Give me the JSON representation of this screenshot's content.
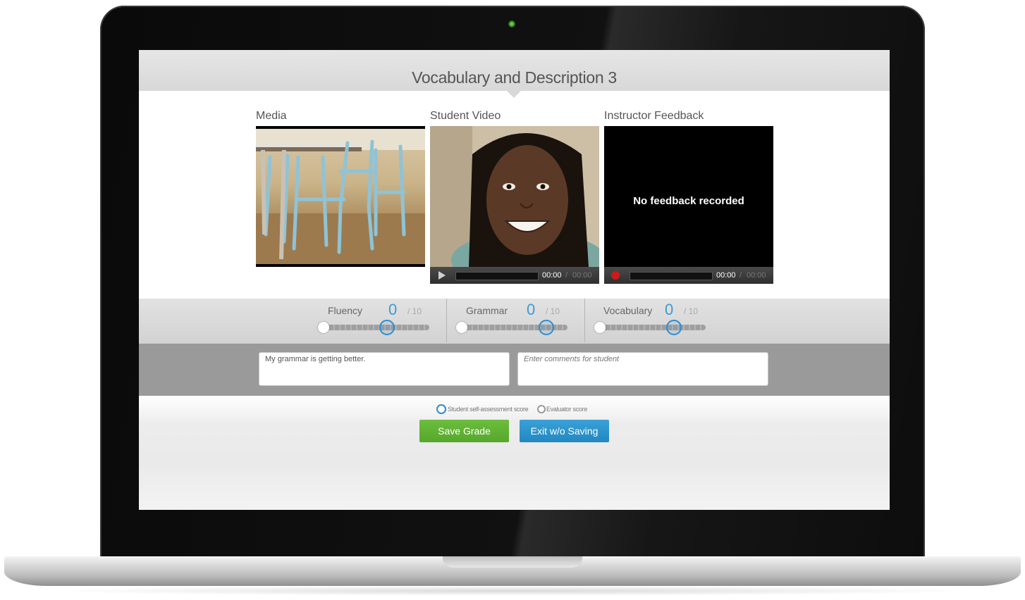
{
  "title": "Vocabulary and Description 3",
  "columns": {
    "media": "Media",
    "student_video": "Student Video",
    "instructor_feedback": "Instructor Feedback"
  },
  "student_video": {
    "time_current": "00:00",
    "time_separator": "/",
    "time_total": "00:00"
  },
  "instructor_feedback": {
    "message": "No feedback recorded",
    "time_current": "00:00",
    "time_separator": "/",
    "time_total": "00:00"
  },
  "scores": [
    {
      "label": "Fluency",
      "value": "0",
      "max": "/ 10"
    },
    {
      "label": "Grammar",
      "value": "0",
      "max": "/ 10"
    },
    {
      "label": "Vocabulary",
      "value": "0",
      "max": "/ 10"
    }
  ],
  "comments": {
    "student_text": "My grammar is getting better.",
    "instructor_placeholder": "Enter comments for student"
  },
  "score_source": {
    "options": [
      "Student self-assessment score",
      "Evaluator score"
    ],
    "selected": "Student self-assessment score"
  },
  "buttons": {
    "save": "Save Grade",
    "exit": "Exit w/o Saving"
  },
  "colors": {
    "accent_blue": "#2f8ccc",
    "save_green": "#5cb032",
    "record_red": "#d01919"
  }
}
